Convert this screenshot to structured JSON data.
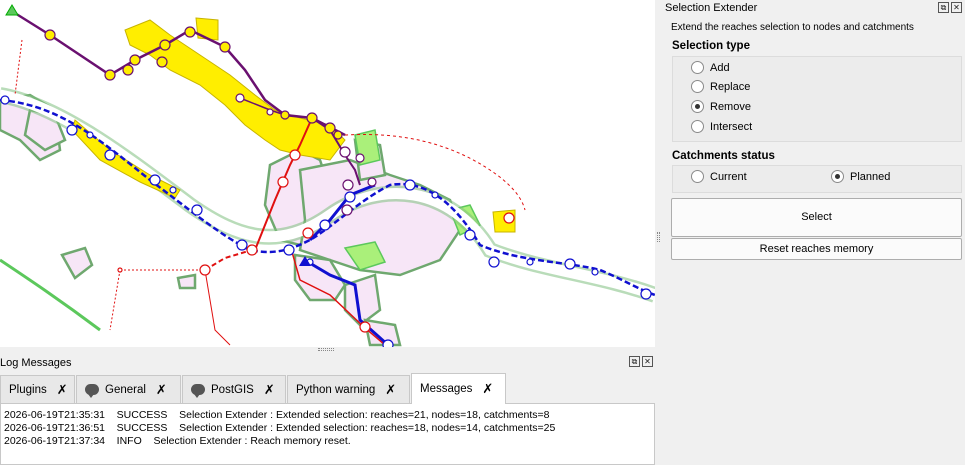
{
  "dock": {
    "title": "Selection Extender",
    "description": "Extend the reaches selection to nodes and catchments",
    "selection_type": {
      "title": "Selection type",
      "options": [
        "Add",
        "Replace",
        "Remove",
        "Intersect"
      ],
      "selected": "Remove"
    },
    "catchments_status": {
      "title": "Catchments status",
      "options": [
        "Current",
        "Planned"
      ],
      "selected": "Planned"
    },
    "select_label": "Select",
    "reset_label": "Reset reaches memory"
  },
  "log": {
    "title": "Log Messages",
    "tabs": [
      {
        "label": "Plugins",
        "icon": "close-icon"
      },
      {
        "label": "General",
        "icon": "chat-bubble-icon"
      },
      {
        "label": "PostGIS",
        "icon": "chat-bubble-icon"
      },
      {
        "label": "Python warning",
        "icon": "close-icon"
      },
      {
        "label": "Messages",
        "icon": "close-icon"
      }
    ],
    "active_tab": "Messages",
    "lines": [
      {
        "time": "2026-06-19T21:35:31",
        "level": "SUCCESS",
        "text": "Selection Extender : Extended selection: reaches=21, nodes=18, catchments=8"
      },
      {
        "time": "2026-06-19T21:36:51",
        "level": "SUCCESS",
        "text": "Selection Extender : Extended selection: reaches=18, nodes=14, catchments=25"
      },
      {
        "time": "2026-06-19T21:37:34",
        "level": "INFO",
        "text": "Selection Extender : Reach memory reset."
      }
    ]
  },
  "colors": {
    "catchment_fill": "#f7e6f7",
    "catchment_stroke": "#6fa86f",
    "selected_yellow": "#ffee00",
    "reach_blue": "#1010d0",
    "reach_red": "#e01010",
    "reach_purple": "#6a1070",
    "green_line": "#5cc85c"
  }
}
